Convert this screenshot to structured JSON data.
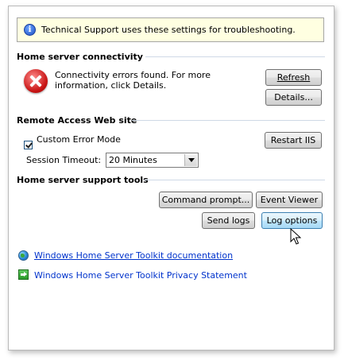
{
  "info_bar": {
    "icon": "info-icon",
    "text": "Technical Support uses these settings for troubleshooting."
  },
  "connectivity": {
    "heading": "Home server connectivity",
    "status_icon": "error-icon",
    "status_line1": "Connectivity errors found. For more",
    "status_line2": "information, click Details.",
    "refresh_label": "Refresh",
    "details_label": "Details..."
  },
  "remote_access": {
    "heading": "Remote Access Web site",
    "custom_error_label": "Custom Error Mode",
    "custom_error_checked": true,
    "restart_label": "Restart IIS",
    "session_timeout_label": "Session Timeout:",
    "session_timeout_value": "20 Minutes"
  },
  "support_tools": {
    "heading": "Home server support tools",
    "command_prompt_label": "Command prompt...",
    "event_viewer_label": "Event Viewer",
    "send_logs_label": "Send logs",
    "log_options_label": "Log options"
  },
  "links": [
    {
      "icon": "globe-icon",
      "text": "Windows Home Server Toolkit documentation"
    },
    {
      "icon": "green-arrow-icon",
      "text": "Windows Home Server Toolkit Privacy Statement"
    }
  ]
}
